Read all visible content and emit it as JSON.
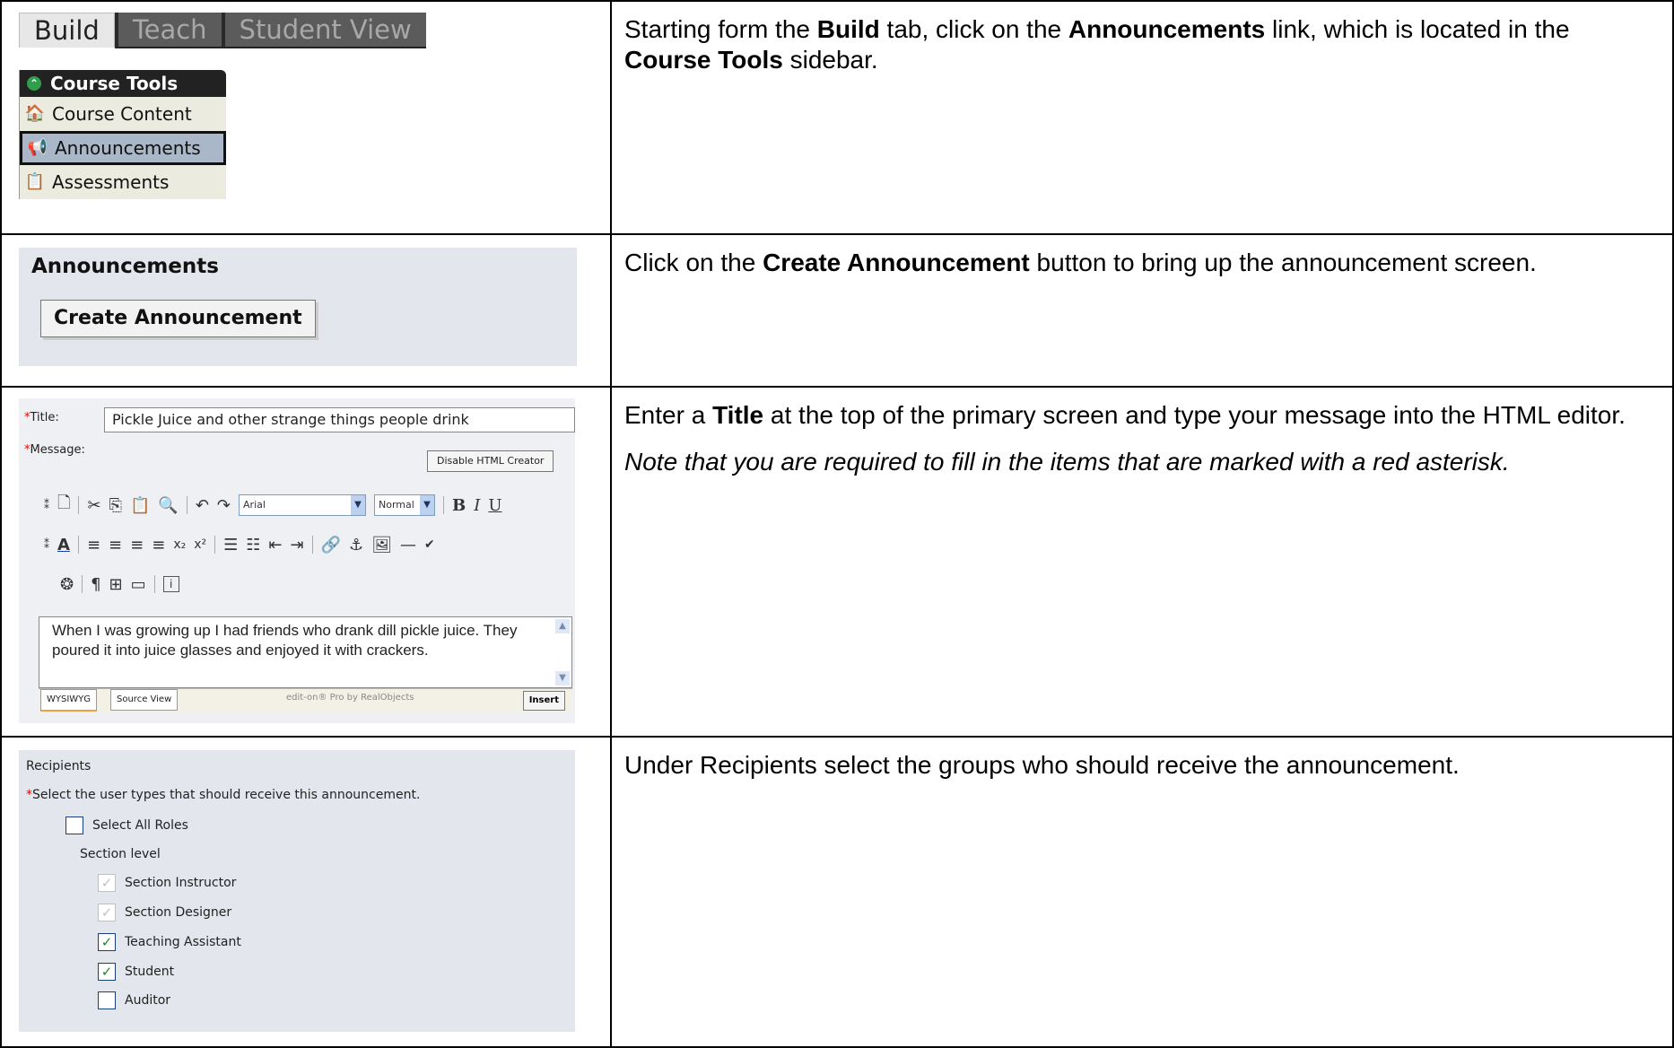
{
  "row1": {
    "tabs": [
      "Build",
      "Teach",
      "Student View"
    ],
    "tools_header": "Course Tools",
    "tools": [
      "Course Content",
      "Announcements",
      "Assessments"
    ],
    "instruction": {
      "t1": "Starting form the ",
      "b1": "Build",
      "t2": " tab, click on the ",
      "b2": "Announcements",
      "t3": " link, which is located in the ",
      "b3": "Course Tools",
      "t4": " sidebar."
    }
  },
  "row2": {
    "heading": "Announcements",
    "button": "Create Announcement",
    "instruction": {
      "t1": "Click on the ",
      "b1": "Create Announcement",
      "t2": " button to bring up the announcement screen."
    }
  },
  "row3": {
    "title_label": "Title:",
    "title_value": "Pickle Juice and other strange things people drink",
    "message_label": "Message:",
    "disable_button": "Disable HTML Creator",
    "font_select": "Arial",
    "size_select": "Normal",
    "body_text": "When I was growing up I had friends who drank dill pickle juice.  They poured it into juice glasses and enjoyed it with crackers.",
    "view_tabs": [
      "WYSIWYG",
      "Source View"
    ],
    "brand": "edit-on® Pro by RealObjects",
    "insert_button": "Insert",
    "instruction": {
      "t1": "Enter a ",
      "b1": "Title",
      "t2": " at the top of the primary screen and type your message into the HTML editor.",
      "note": "Note that you are required to fill in the items that are marked with a red asterisk."
    }
  },
  "row4": {
    "heading": "Recipients",
    "prompt": "Select the user types that should receive this announcement.",
    "select_all": "Select All Roles",
    "section_level": "Section level",
    "roles": [
      {
        "label": "Section Instructor",
        "state": "checked-disabled"
      },
      {
        "label": "Section Designer",
        "state": "checked-disabled"
      },
      {
        "label": "Teaching Assistant",
        "state": "checked"
      },
      {
        "label": "Student",
        "state": "checked"
      },
      {
        "label": "Auditor",
        "state": "unchecked"
      }
    ],
    "instruction": "Under Recipients select the groups who should receive the announcement."
  }
}
